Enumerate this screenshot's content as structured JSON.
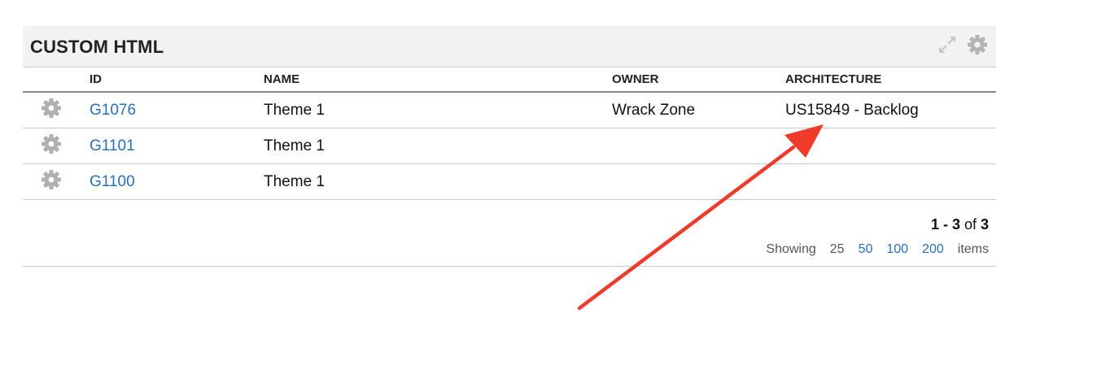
{
  "panel": {
    "title": "CUSTOM HTML",
    "header_icons": [
      "expand-icon",
      "settings-gear-icon"
    ]
  },
  "table": {
    "columns": [
      "",
      "ID",
      "NAME",
      "OWNER",
      "ARCHITECTURE"
    ],
    "rows": [
      {
        "icon": "gear-icon",
        "id": "G1076",
        "name": "Theme 1",
        "owner": "Wrack Zone",
        "architecture": "US15849 - Backlog"
      },
      {
        "icon": "gear-icon",
        "id": "G1101",
        "name": "Theme 1",
        "owner": "",
        "architecture": ""
      },
      {
        "icon": "gear-icon",
        "id": "G1100",
        "name": "Theme 1",
        "owner": "",
        "architecture": ""
      }
    ]
  },
  "pagination": {
    "range_start": "1",
    "range_sep": " - ",
    "range_end": "3",
    "of_label": " of ",
    "total": "3",
    "showing_label": "Showing",
    "page_size_options": [
      "25",
      "50",
      "100",
      "200"
    ],
    "selected_page_size": "25",
    "items_label": "items"
  },
  "annotation": {
    "type": "arrow",
    "color": "#f03a2a"
  },
  "colors": {
    "link": "#2a6eb8",
    "header_bg": "#f2f2f2",
    "icon_gray": "#b0b0b0"
  }
}
